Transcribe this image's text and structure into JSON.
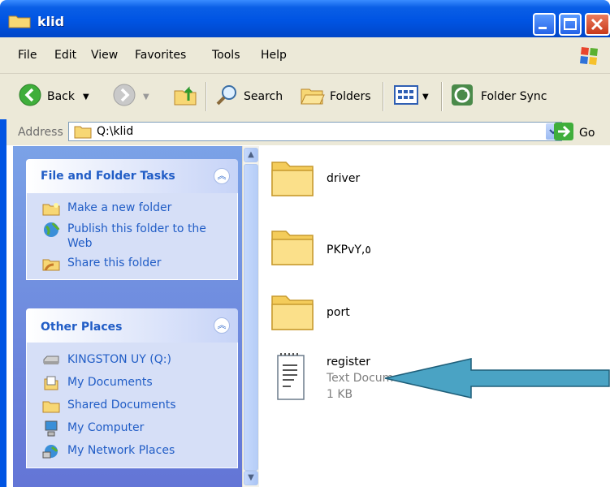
{
  "window": {
    "title": "klid"
  },
  "menu": [
    "File",
    "Edit",
    "View",
    "Favorites",
    "Tools",
    "Help"
  ],
  "toolbar": {
    "back": "Back",
    "search": "Search",
    "folders": "Folders",
    "folder_sync": "Folder Sync"
  },
  "address": {
    "label": "Address",
    "value": "Q:\\klid",
    "go": "Go"
  },
  "tasks_panel": {
    "title": "File and Folder Tasks",
    "items": [
      {
        "label": "Make a new folder",
        "icon": "new-folder-icon"
      },
      {
        "label": "Publish this folder to the Web",
        "icon": "publish-web-icon"
      },
      {
        "label": "Share this folder",
        "icon": "share-folder-icon"
      }
    ]
  },
  "places_panel": {
    "title": "Other Places",
    "items": [
      {
        "label": "KINGSTON UY (Q:)",
        "icon": "drive-icon"
      },
      {
        "label": "My Documents",
        "icon": "my-documents-icon"
      },
      {
        "label": "Shared Documents",
        "icon": "shared-documents-icon"
      },
      {
        "label": "My Computer",
        "icon": "my-computer-icon"
      },
      {
        "label": "My Network Places",
        "icon": "network-places-icon"
      }
    ]
  },
  "files": [
    {
      "name": "driver",
      "type": "folder"
    },
    {
      "name": "PKPvY,٥",
      "type": "folder"
    },
    {
      "name": "port",
      "type": "folder"
    },
    {
      "name": "register",
      "type": "text",
      "detail": "Text Docum",
      "size": "1 KB"
    }
  ],
  "colors": {
    "titlebar": "#0054e3",
    "panel_title": "#215dc6",
    "arrow": "#4aa3c4"
  }
}
